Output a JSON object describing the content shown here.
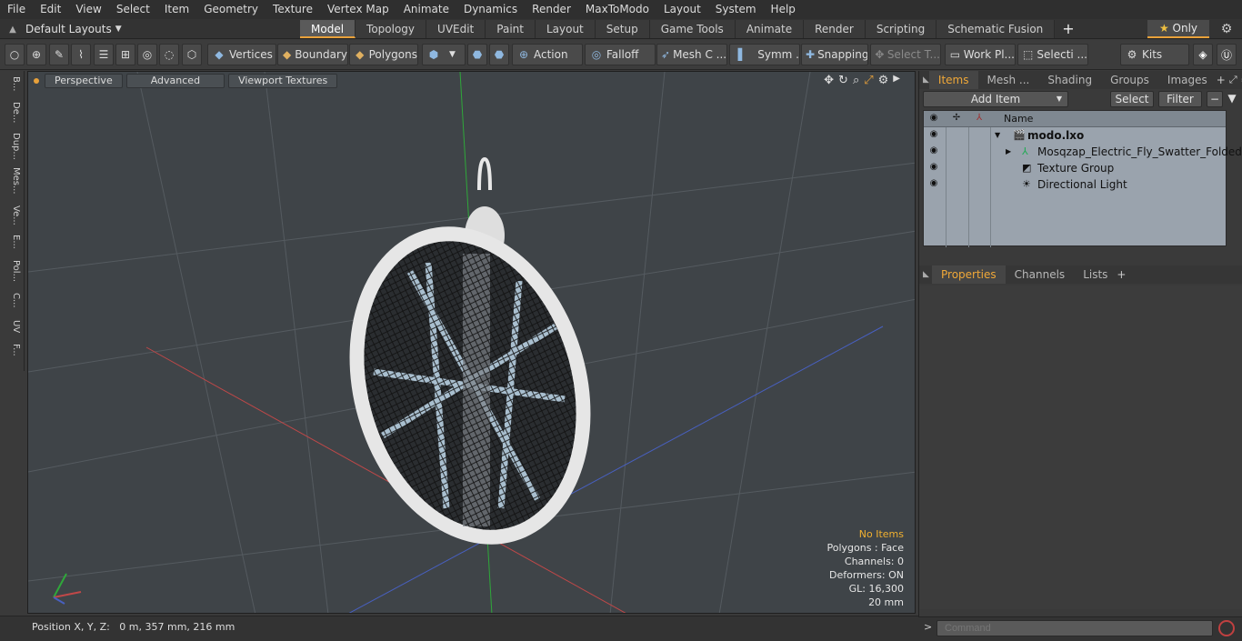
{
  "menu": [
    "File",
    "Edit",
    "View",
    "Select",
    "Item",
    "Geometry",
    "Texture",
    "Vertex Map",
    "Animate",
    "Dynamics",
    "Render",
    "MaxToModo",
    "Layout",
    "System",
    "Help"
  ],
  "layouts": {
    "label": "Default Layouts"
  },
  "tabs": [
    "Model",
    "Topology",
    "UVEdit",
    "Paint",
    "Layout",
    "Setup",
    "Game Tools",
    "Animate",
    "Render",
    "Scripting",
    "Schematic Fusion"
  ],
  "only_label": "Only",
  "toolbar": {
    "vertices": "Vertices",
    "boundary": "Boundary",
    "polygons": "Polygons",
    "action": "Action",
    "falloff": "Falloff",
    "mesh": "Mesh C ...",
    "symm": "Symm ...",
    "snapping": "Snapping",
    "select_t": "Select T...",
    "workpl": "Work Pl...",
    "selecti": "Selecti ...",
    "kits": "Kits"
  },
  "left_tabs": [
    "B...",
    "De...",
    "Dup...",
    "Mes...",
    "Ve...",
    "E...",
    "Pol...",
    "C...",
    "UV",
    "F..."
  ],
  "viewport": {
    "perspective": "Perspective",
    "advanced": "Advanced",
    "textures": "Viewport Textures",
    "stats": {
      "items": "No Items",
      "polygons": "Polygons : Face",
      "channels": "Channels: 0",
      "deformers": "Deformers: ON",
      "gl": "GL: 16,300",
      "scale": "20 mm"
    }
  },
  "status": {
    "position": "Position X, Y, Z:   0 m, 357 mm, 216 mm"
  },
  "panel_tabs": [
    "Items",
    "Mesh ...",
    "Shading",
    "Groups",
    "Images"
  ],
  "items": {
    "add_item": "Add Item",
    "select": "Select",
    "filter": "Filter",
    "name_header": "Name",
    "rows": [
      {
        "name": "modo.lxo",
        "indent": 0
      },
      {
        "name": "Mosqzap_Electric_Fly_Swatter_Folded",
        "indent": 1
      },
      {
        "name": "Texture Group",
        "indent": 1
      },
      {
        "name": "Directional Light",
        "indent": 1
      }
    ]
  },
  "properties_tabs": [
    "Properties",
    "Channels",
    "Lists"
  ],
  "command": {
    "placeholder": "Command"
  }
}
